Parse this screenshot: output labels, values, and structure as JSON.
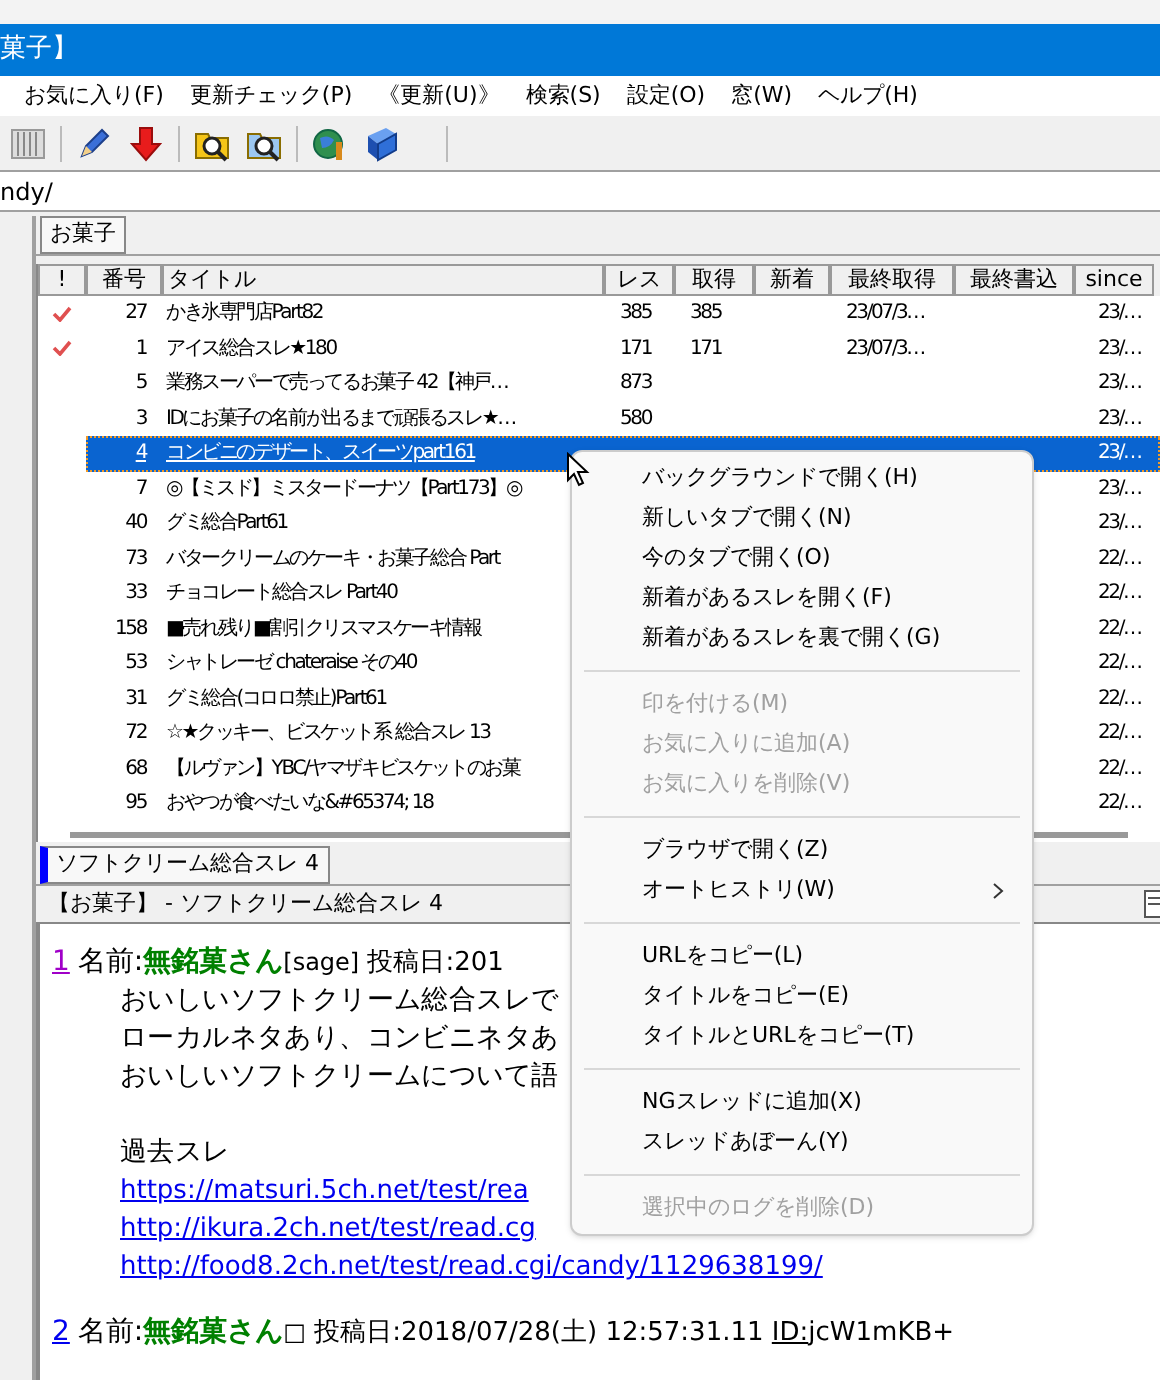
{
  "window": {
    "title": "菓子】"
  },
  "menu_bar": [
    "お気に入り(F)",
    "更新チェック(P)",
    "《更新(U)》",
    "検索(S)",
    "設定(O)",
    "窓(W)",
    "ヘルプ(H)"
  ],
  "address_bar": {
    "value": "ndy/"
  },
  "board_tabs": [
    {
      "label": "お菓子",
      "selected": true
    }
  ],
  "thread_list": {
    "columns": [
      "!",
      "番号",
      "タイトル",
      "レス",
      "取得",
      "新着",
      "最終取得",
      "最終書込",
      "since"
    ],
    "rows": [
      {
        "checked": true,
        "selected": false,
        "number": "27",
        "title": "かき氷専門店Part82",
        "res": "385",
        "got": "385",
        "last_got": "23/07/3…",
        "since": "23/…"
      },
      {
        "checked": true,
        "selected": false,
        "number": "1",
        "title": "アイス総合スレ★180",
        "res": "171",
        "got": "171",
        "last_got": "23/07/3…",
        "since": "23/…"
      },
      {
        "checked": false,
        "selected": false,
        "number": "5",
        "title": "業務スーパーで売ってるお菓子 42【神戸…",
        "res": "873",
        "since": "23/…"
      },
      {
        "checked": false,
        "selected": false,
        "number": "3",
        "title": "IDにお菓子の名前が出るまで頑張るスレ★…",
        "res": "580",
        "since": "23/…"
      },
      {
        "checked": false,
        "selected": true,
        "number": "4",
        "title": "コンビニのデザート、スイーツpart161",
        "since": "23/…"
      },
      {
        "checked": false,
        "selected": false,
        "number": "7",
        "title": "◎【ミスド】ミスタードーナツ【Part173】◎",
        "since": "23/…"
      },
      {
        "checked": false,
        "selected": false,
        "number": "40",
        "title": "グミ総合Part61",
        "since": "23/…"
      },
      {
        "checked": false,
        "selected": false,
        "number": "73",
        "title": "バタークリームのケーキ・お菓子総合 Part",
        "since": "22/…"
      },
      {
        "checked": false,
        "selected": false,
        "number": "33",
        "title": "チョコレート総合スレ Part40",
        "since": "22/…"
      },
      {
        "checked": false,
        "selected": false,
        "number": "158",
        "title": "■売れ残り■割引クリスマスケーキ情報",
        "since": "22/…"
      },
      {
        "checked": false,
        "selected": false,
        "number": "53",
        "title": "シャトレーゼ chateraise その40",
        "since": "22/…"
      },
      {
        "checked": false,
        "selected": false,
        "number": "31",
        "title": "グミ総合(コロロ禁止)Part61",
        "since": "22/…"
      },
      {
        "checked": false,
        "selected": false,
        "number": "72",
        "title": "☆★クッキー、ビスケット系 総合スレ 13",
        "since": "22/…"
      },
      {
        "checked": false,
        "selected": false,
        "number": "68",
        "title": "【ルヴァン】YBC/ヤマザキビスケットのお菓",
        "since": "22/…"
      },
      {
        "checked": false,
        "selected": false,
        "number": "95",
        "title": "おやつが食べたいな&#65374; 18",
        "since": "22/…"
      }
    ]
  },
  "thread_tabs": [
    {
      "label": "ソフトクリーム総合スレ 4",
      "selected": true
    }
  ],
  "thread_title": "【お菓子】 - ソフトクリーム総合スレ 4",
  "posts": [
    {
      "number": "1",
      "visited": true,
      "name_label": "名前:",
      "name": "無銘菓さん",
      "mail": "[sage]",
      "date": " 投稿日:201",
      "body": [
        {
          "kind": "text",
          "text": "おいしいソフトクリーム総合スレで"
        },
        {
          "kind": "text",
          "text": "ローカルネタあり、コンビニネタあ"
        },
        {
          "kind": "text",
          "text": "おいしいソフトクリームについて語"
        },
        {
          "kind": "blank"
        },
        {
          "kind": "text",
          "text": "過去スレ"
        },
        {
          "kind": "link",
          "text": "https://matsuri.5ch.net/test/rea"
        },
        {
          "kind": "link",
          "text": "http://ikura.2ch.net/test/read.cg"
        },
        {
          "kind": "link",
          "text": "http://food8.2ch.net/test/read.cgi/candy/1129638199/"
        }
      ]
    },
    {
      "number": "2",
      "visited": false,
      "name_label": "名前:",
      "name": "無銘菓さん",
      "mail": "□",
      "date": " 投稿日:2018/07/28(土) 12:57:31.11 ",
      "id_label": "ID:",
      "id": "jcW1mKB+"
    }
  ],
  "context_menu": [
    {
      "kind": "item",
      "label": "バックグラウンドで開く(H)",
      "disabled": false
    },
    {
      "kind": "item",
      "label": "新しいタブで開く(N)",
      "disabled": false
    },
    {
      "kind": "item",
      "label": "今のタブで開く(O)",
      "disabled": false
    },
    {
      "kind": "item",
      "label": "新着があるスレを開く(F)",
      "disabled": false
    },
    {
      "kind": "item",
      "label": "新着があるスレを裏で開く(G)",
      "disabled": false
    },
    {
      "kind": "separator"
    },
    {
      "kind": "item",
      "label": "印を付ける(M)",
      "disabled": true
    },
    {
      "kind": "item",
      "label": "お気に入りに追加(A)",
      "disabled": true
    },
    {
      "kind": "item",
      "label": "お気に入りを削除(V)",
      "disabled": true
    },
    {
      "kind": "separator"
    },
    {
      "kind": "item",
      "label": "ブラウザで開く(Z)",
      "disabled": false
    },
    {
      "kind": "submenu",
      "label": "オートヒストリ(W)",
      "disabled": false
    },
    {
      "kind": "separator"
    },
    {
      "kind": "item",
      "label": "URLをコピー(L)",
      "disabled": false
    },
    {
      "kind": "item",
      "label": "タイトルをコピー(E)",
      "disabled": false
    },
    {
      "kind": "item",
      "label": "タイトルとURLをコピー(T)",
      "disabled": false
    },
    {
      "kind": "separator"
    },
    {
      "kind": "item",
      "label": "NGスレッドに追加(X)",
      "disabled": false
    },
    {
      "kind": "item",
      "label": "スレッドあぼーん(Y)",
      "disabled": false
    },
    {
      "kind": "separator"
    },
    {
      "kind": "item",
      "label": "選択中のログを削除(D)",
      "disabled": true
    }
  ]
}
